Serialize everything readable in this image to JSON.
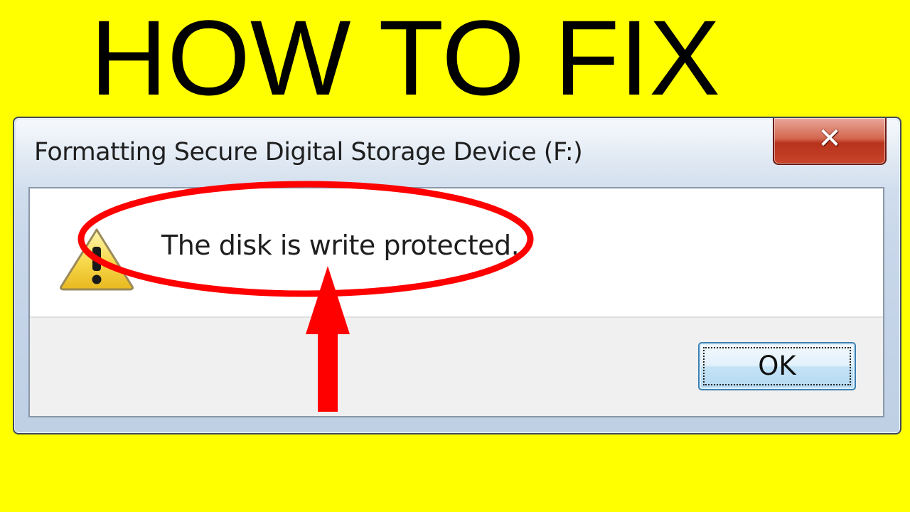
{
  "headline": "HOW TO FIX",
  "dialog": {
    "title": "Formatting Secure Digital Storage Device (F:)",
    "close_icon": "close-icon",
    "message": "The disk is write protected.",
    "message_icon": "warning-icon",
    "ok_label": "OK"
  },
  "annotation": {
    "highlight_shape": "ellipse",
    "pointer_shape": "arrow-up",
    "color": "#ff0000"
  },
  "colors": {
    "background": "#ffff00",
    "close_button": "#c8442a",
    "ok_button_border": "#3c7fb1"
  }
}
